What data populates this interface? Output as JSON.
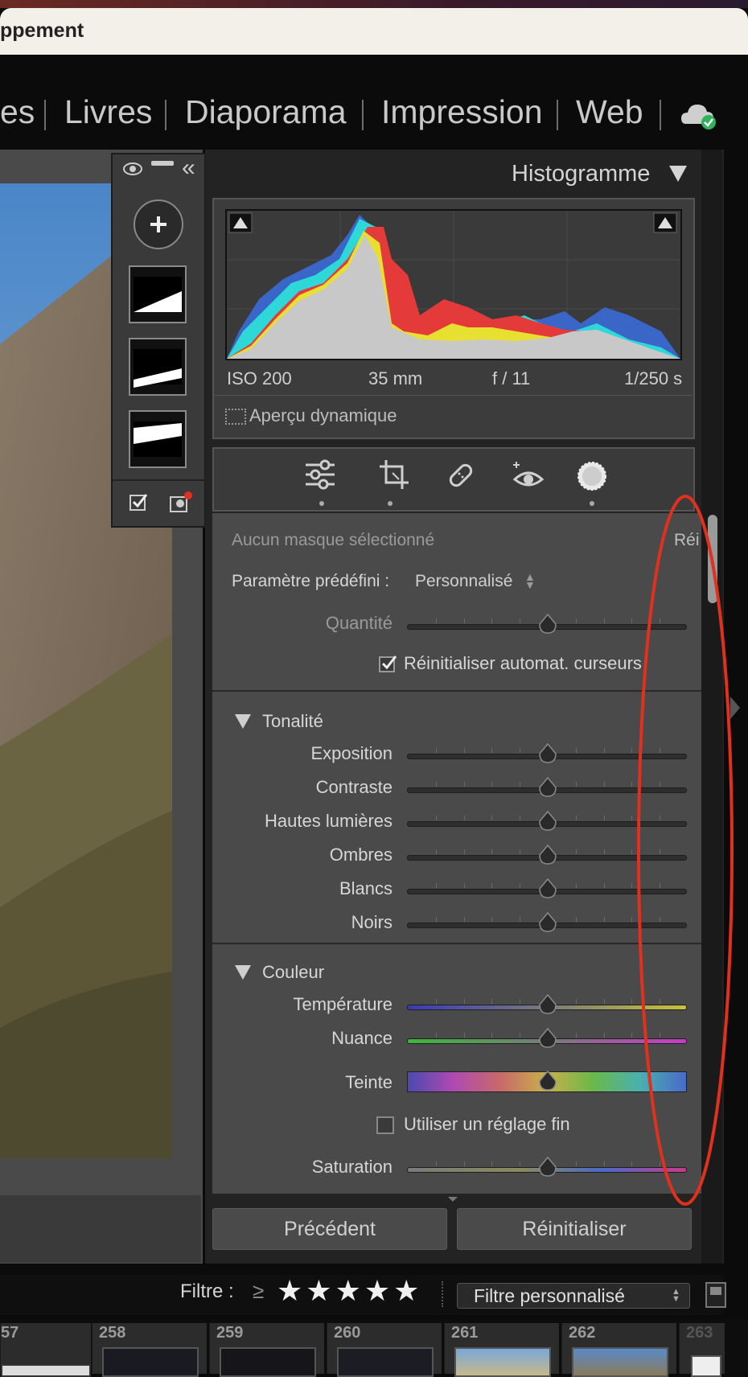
{
  "window": {
    "title": "ppement"
  },
  "nav": {
    "items": [
      "es",
      "Livres",
      "Diaporama",
      "Impression",
      "Web"
    ]
  },
  "histogram": {
    "title": "Histogramme",
    "iso": "ISO 200",
    "focal": "35 mm",
    "aperture": "f / 11",
    "shutter": "1/250 s",
    "preview_label": "Aperçu dynamique"
  },
  "tools": [
    "sliders-icon",
    "crop-icon",
    "heal-icon",
    "redeye-icon",
    "mask-icon"
  ],
  "mask": {
    "status": "Aucun masque sélectionné",
    "reset_short": "Réi",
    "preset_label": "Paramètre prédéfini :",
    "preset_value": "Personnalisé",
    "amount_label": "Quantité",
    "amount_value": 0.5,
    "auto_reset_label": "Réinitialiser automat. curseurs",
    "auto_reset_checked": true
  },
  "tonalite": {
    "header": "Tonalité",
    "sliders": [
      {
        "label": "Exposition",
        "value": 0.5
      },
      {
        "label": "Contraste",
        "value": 0.5
      },
      {
        "label": "Hautes lumières",
        "value": 0.5
      },
      {
        "label": "Ombres",
        "value": 0.5
      },
      {
        "label": "Blancs",
        "value": 0.5
      },
      {
        "label": "Noirs",
        "value": 0.5
      }
    ]
  },
  "couleur": {
    "header": "Couleur",
    "temperature_label": "Température",
    "nuance_label": "Nuance",
    "teinte_label": "Teinte",
    "fine_label": "Utiliser un réglage fin",
    "fine_checked": false,
    "saturation_label": "Saturation"
  },
  "buttons": {
    "previous": "Précédent",
    "reset": "Réinitialiser"
  },
  "filter": {
    "label": "Filtre :",
    "op": "≥",
    "stars": [
      "★",
      "★",
      "★",
      "★",
      "★"
    ],
    "custom": "Filtre personnalisé"
  },
  "filmstrip": [
    "57",
    "258",
    "259",
    "260",
    "261",
    "262",
    "263"
  ],
  "colors": {
    "annotation": "#e0301e",
    "accent_green": "#2fb35b"
  }
}
